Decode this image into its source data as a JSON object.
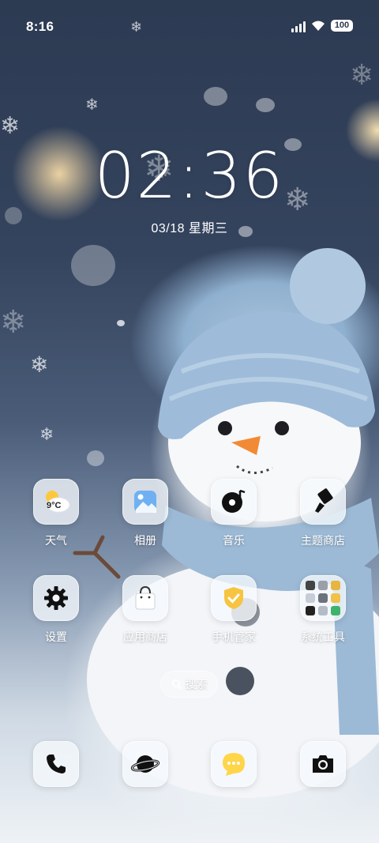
{
  "status_bar": {
    "time": "8:16",
    "battery": "100"
  },
  "lockclock": {
    "time": "02:36",
    "date": "03/18 星期三"
  },
  "apps": [
    {
      "label": "天气",
      "icon": "weather-icon",
      "temp": "9°C"
    },
    {
      "label": "相册",
      "icon": "gallery-icon"
    },
    {
      "label": "音乐",
      "icon": "music-icon"
    },
    {
      "label": "主题商店",
      "icon": "theme-brush-icon"
    },
    {
      "label": "设置",
      "icon": "gear-icon"
    },
    {
      "label": "应用商店",
      "icon": "shopping-bag-icon"
    },
    {
      "label": "手机管家",
      "icon": "shield-check-icon"
    },
    {
      "label": "系统工具",
      "icon": "folder-icon"
    }
  ],
  "search": {
    "label": "搜索"
  },
  "dock": [
    {
      "icon": "phone-icon"
    },
    {
      "icon": "planet-browser-icon"
    },
    {
      "icon": "message-icon"
    },
    {
      "icon": "camera-icon"
    }
  ],
  "colors": {
    "tile_bg": "#f5f8fc",
    "weather_sun": "#ffc83a",
    "gallery_blue": "#6fb0f2",
    "security_yellow": "#f6c440"
  }
}
